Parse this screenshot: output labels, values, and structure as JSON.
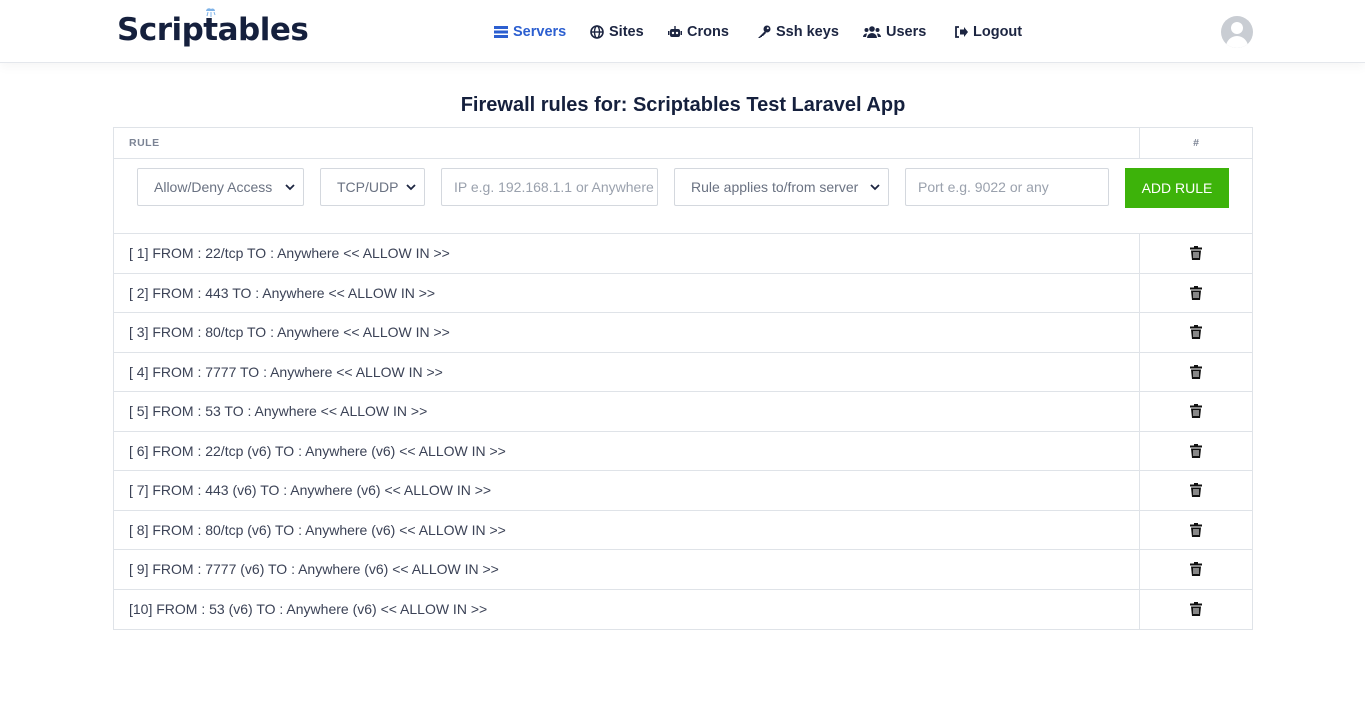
{
  "brand": {
    "name": "Scriptables"
  },
  "nav": {
    "items": [
      {
        "label": "Servers",
        "icon": "server-icon",
        "active": true
      },
      {
        "label": "Sites",
        "icon": "globe-icon",
        "active": false
      },
      {
        "label": "Crons",
        "icon": "robot-icon",
        "active": false
      },
      {
        "label": "Ssh keys",
        "icon": "key-icon",
        "active": false
      },
      {
        "label": "Users",
        "icon": "users-icon",
        "active": false
      },
      {
        "label": "Logout",
        "icon": "logout-icon",
        "active": false
      }
    ]
  },
  "page": {
    "title": "Firewall rules for: Scriptables Test Laravel App"
  },
  "table": {
    "headers": {
      "rule": "RULE",
      "action": "#"
    },
    "form": {
      "access_select": "Allow/Deny Access",
      "protocol_select": "TCP/UDP",
      "ip_placeholder": "IP e.g. 192.168.1.1 or Anywhere",
      "direction_select": "Rule applies to/from server",
      "port_placeholder": "Port e.g. 9022 or any",
      "add_button": "ADD RULE"
    },
    "rules": [
      "[ 1] FROM : 22/tcp TO : Anywhere << ALLOW IN >>",
      "[ 2] FROM : 443 TO : Anywhere << ALLOW IN >>",
      "[ 3] FROM : 80/tcp TO : Anywhere << ALLOW IN >>",
      "[ 4] FROM : 7777 TO : Anywhere << ALLOW IN >>",
      "[ 5] FROM : 53 TO : Anywhere << ALLOW IN >>",
      "[ 6] FROM : 22/tcp (v6) TO : Anywhere (v6) << ALLOW IN >>",
      "[ 7] FROM : 443 (v6) TO : Anywhere (v6) << ALLOW IN >>",
      "[ 8] FROM : 80/tcp (v6) TO : Anywhere (v6) << ALLOW IN >>",
      "[ 9] FROM : 7777 (v6) TO : Anywhere (v6) << ALLOW IN >>",
      "[10] FROM : 53 (v6) TO : Anywhere (v6) << ALLOW IN >>"
    ]
  },
  "colors": {
    "accent": "#2c5fd0",
    "add_button": "#3db30a",
    "text": "#15203d"
  }
}
